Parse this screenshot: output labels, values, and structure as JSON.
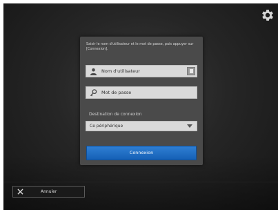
{
  "login": {
    "instruction": "Saisir le nom d'utilisateur et le mot de passe, puis appuyer sur [Connexion].",
    "username_placeholder": "Nom d'utilisateur",
    "password_placeholder": "Mot de passe",
    "destination_label": "Destination de connexion",
    "destination_value": "Ce périphérique",
    "connect_label": "Connexion"
  },
  "footer": {
    "cancel_label": "Annuler"
  },
  "icons": {
    "settings": "gear-icon",
    "user": "user-icon",
    "key": "key-icon",
    "keyboard": "keyboard-icon",
    "dropdown": "chevron-down-icon",
    "cancel": "close-icon"
  },
  "colors": {
    "accent": "#1f6fc5",
    "panel": "#4a4a4a",
    "background": "#262626"
  }
}
